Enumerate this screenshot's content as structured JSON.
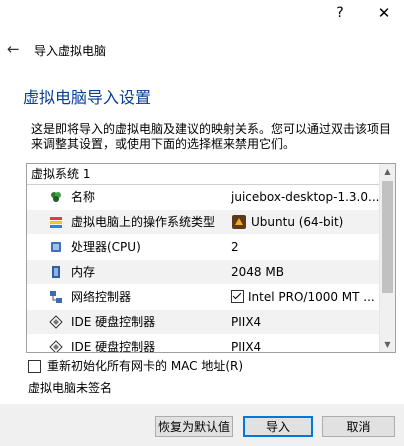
{
  "titlebar": {
    "help": "?",
    "close": "✕"
  },
  "header": {
    "back": "←",
    "wizard_title": "导入虚拟电脑"
  },
  "page": {
    "heading": "虚拟电脑导入设置",
    "description": "这是即将导入的虚拟电脑及建议的映射关系。您可以通过双击该项目来调整其设置，或使用下面的选择框来禁用它们。"
  },
  "list": {
    "group": "虚拟系统 1",
    "rows": [
      {
        "icon": "name-icon",
        "label": "名称",
        "value": "juicebox-desktop-1.3.0..."
      },
      {
        "icon": "os-type-icon",
        "label": "虚拟电脑上的操作系统类型",
        "value": "Ubuntu (64-bit)"
      },
      {
        "icon": "cpu-icon",
        "label": "处理器(CPU)",
        "value": "2"
      },
      {
        "icon": "memory-icon",
        "label": "内存",
        "value": "2048 MB"
      },
      {
        "icon": "network-icon",
        "label": "网络控制器",
        "value": "Intel PRO/1000 MT ..."
      },
      {
        "icon": "ide-icon",
        "label": "IDE 硬盘控制器",
        "value": "PIIX4"
      },
      {
        "icon": "ide-icon",
        "label": "IDE 硬盘控制器",
        "value": "PIIX4"
      }
    ],
    "scrollbar": {
      "up": "▲",
      "down": "▼"
    }
  },
  "options": {
    "reinit_mac": "重新初始化所有网卡的 MAC 地址(R)",
    "unsigned": "虚拟电脑未签名"
  },
  "buttons": {
    "restore": "恢复为默认值",
    "import": "导入",
    "cancel": "取消"
  },
  "colors": {
    "heading": "#0b3d91",
    "accent": "#0078d7"
  }
}
